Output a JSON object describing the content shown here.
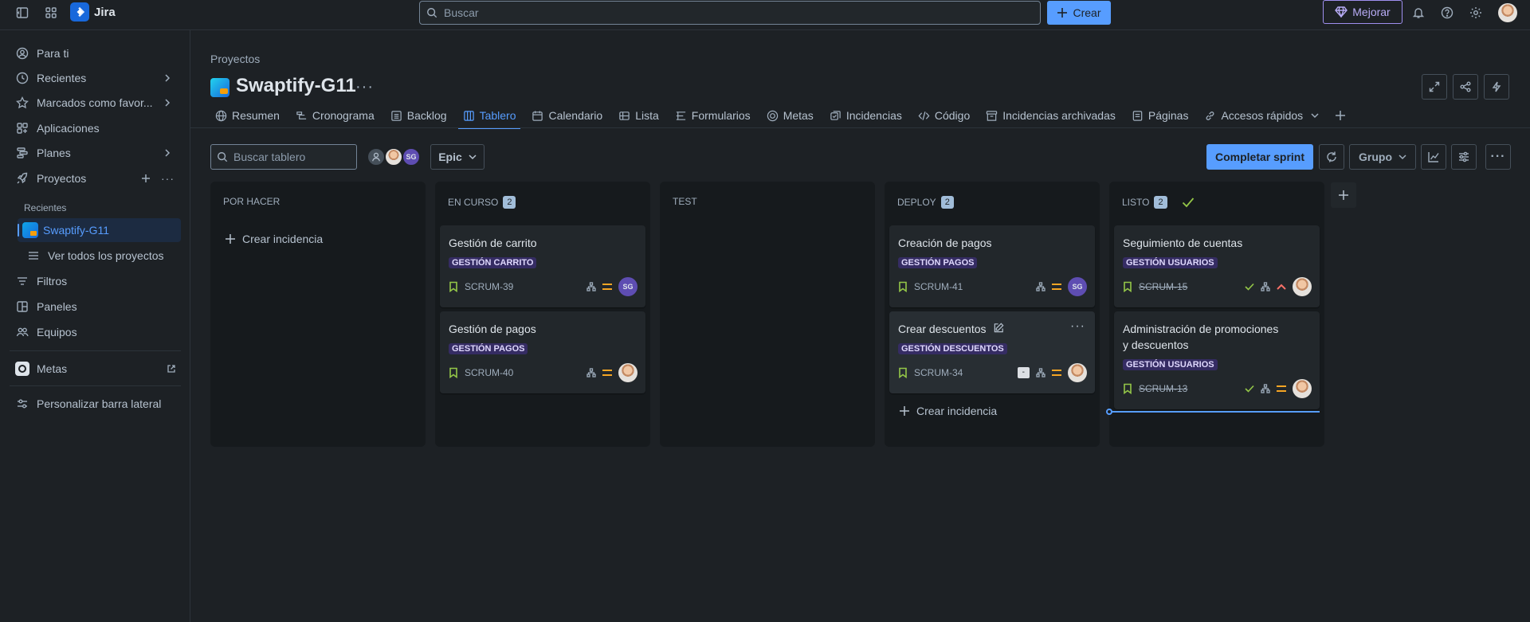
{
  "topbar": {
    "app_name": "Jira",
    "search_placeholder": "Buscar",
    "create_label": "Crear",
    "upgrade_label": "Mejorar"
  },
  "sidebar": {
    "for_you": "Para ti",
    "recent": "Recientes",
    "starred": "Marcados como favor...",
    "apps": "Aplicaciones",
    "plans": "Planes",
    "projects": "Proyectos",
    "projects_recent_heading": "Recientes",
    "current_project": "Swaptify-G11",
    "view_all_projects": "Ver todos los proyectos",
    "filters": "Filtros",
    "dashboards": "Paneles",
    "teams": "Equipos",
    "goals": "Metas",
    "customize": "Personalizar barra lateral"
  },
  "header": {
    "breadcrumb": "Proyectos",
    "title": "Swaptify-G11"
  },
  "tabs": [
    {
      "label": "Resumen"
    },
    {
      "label": "Cronograma"
    },
    {
      "label": "Backlog"
    },
    {
      "label": "Tablero"
    },
    {
      "label": "Calendario"
    },
    {
      "label": "Lista"
    },
    {
      "label": "Formularios"
    },
    {
      "label": "Metas"
    },
    {
      "label": "Incidencias"
    },
    {
      "label": "Código"
    },
    {
      "label": "Incidencias archivadas"
    },
    {
      "label": "Páginas"
    },
    {
      "label": "Accesos rápidos"
    }
  ],
  "toolbar": {
    "search_placeholder": "Buscar tablero",
    "avatar_initials": "SG",
    "epic_label": "Epic",
    "complete_sprint": "Completar sprint",
    "group_label": "Grupo"
  },
  "board": {
    "create_issue": "Crear incidencia",
    "columns": [
      {
        "name": "POR HACER",
        "count": ""
      },
      {
        "name": "EN CURSO",
        "count": "2"
      },
      {
        "name": "TEST",
        "count": ""
      },
      {
        "name": "DEPLOY",
        "count": "2"
      },
      {
        "name": "LISTO",
        "count": "2"
      }
    ],
    "cards": {
      "c39": {
        "title": "Gestión de carrito",
        "epic": "GESTIÓN CARRITO",
        "key": "SCRUM-39",
        "assignee": "SG"
      },
      "c40": {
        "title": "Gestión de pagos",
        "epic": "GESTIÓN PAGOS",
        "key": "SCRUM-40"
      },
      "c41": {
        "title": "Creación de pagos",
        "epic": "GESTIÓN PAGOS",
        "key": "SCRUM-41",
        "assignee": "SG"
      },
      "c34": {
        "title": "Crear descuentos",
        "epic": "GESTIÓN DESCUENTOS",
        "key": "SCRUM-34",
        "estimate": "-"
      },
      "c15": {
        "title": "Seguimiento de cuentas",
        "epic": "GESTIÓN USUARIOS",
        "key": "SCRUM-15"
      },
      "c13": {
        "title": "Administración de promociones y descuentos",
        "epic": "GESTIÓN USUARIOS",
        "key": "SCRUM-13"
      }
    }
  },
  "colors": {
    "accent": "#579dff",
    "epic_bg": "#352c63",
    "priority_medium": "#f5a524",
    "priority_high": "#f87168",
    "story_green": "#94c748"
  }
}
